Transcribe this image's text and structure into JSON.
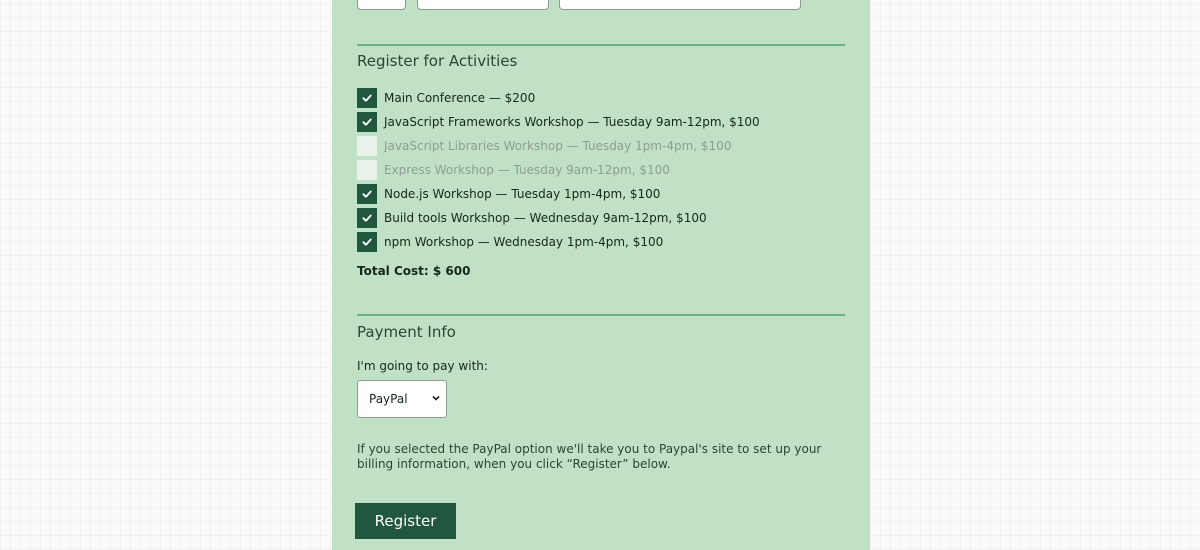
{
  "activities_section": {
    "legend": "Register for Activities",
    "items": [
      {
        "label": "Main Conference — $200",
        "checked": true,
        "disabled": false
      },
      {
        "label": "JavaScript Frameworks Workshop — Tuesday 9am-12pm, $100",
        "checked": true,
        "disabled": false
      },
      {
        "label": "JavaScript Libraries Workshop — Tuesday 1pm-4pm, $100",
        "checked": false,
        "disabled": true
      },
      {
        "label": "Express Workshop — Tuesday 9am-12pm, $100",
        "checked": false,
        "disabled": true
      },
      {
        "label": "Node.js Workshop — Tuesday 1pm-4pm, $100",
        "checked": true,
        "disabled": false
      },
      {
        "label": "Build tools Workshop — Wednesday 9am-12pm, $100",
        "checked": true,
        "disabled": false
      },
      {
        "label": "npm Workshop — Wednesday 1pm-4pm, $100",
        "checked": true,
        "disabled": false
      }
    ],
    "total": "Total Cost: $ 600"
  },
  "payment_section": {
    "legend": "Payment Info",
    "pay_label": "I'm going to pay with:",
    "selected_option": "PayPal",
    "paypal_note": "If you selected the PayPal option we'll take you to Paypal's site to set up your billing information, when you click “Register” below."
  },
  "form": {
    "register_label": "Register"
  },
  "colors": {
    "panel_background": "#c1e1c6",
    "accent": "#22573f",
    "rule": "#6fb287"
  },
  "icons": {
    "checkmark": "checkmark-icon",
    "dropdown": "chevron-down-icon"
  }
}
